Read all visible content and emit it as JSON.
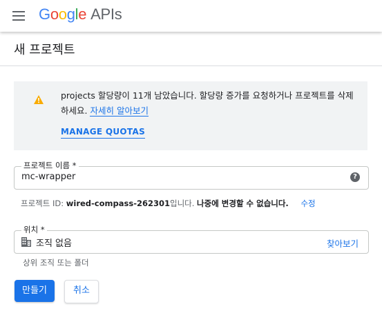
{
  "header": {
    "logo_letters": [
      "G",
      "o",
      "o",
      "g",
      "l",
      "e"
    ],
    "logo_suffix": "APIs"
  },
  "page": {
    "title": "새 프로젝트"
  },
  "notice": {
    "message": "projects 할당량이 11개 남았습니다. 할당량 증가를 요청하거나 프로젝트를 삭제하세요.",
    "learn_more": "자세히 알아보기",
    "manage_quotas": "MANAGE QUOTAS"
  },
  "project_name": {
    "label": "프로젝트 이름 *",
    "value": "mc-wrapper",
    "help_icon": "?"
  },
  "project_id": {
    "prefix": "프로젝트 ID: ",
    "id": "wired-compass-262301",
    "suffix_normal": "입니다. ",
    "suffix_bold": "나중에 변경할 수 없습니다.",
    "edit": "수정"
  },
  "location": {
    "label": "위치 *",
    "value": "조직 없음",
    "browse": "찾아보기",
    "hint": "상위 조직 또는 폴더"
  },
  "actions": {
    "create": "만들기",
    "cancel": "취소"
  },
  "colors": {
    "accent": "#1a73e8",
    "warning": "#f9ab00",
    "notice_bg": "#f1f3f4"
  }
}
